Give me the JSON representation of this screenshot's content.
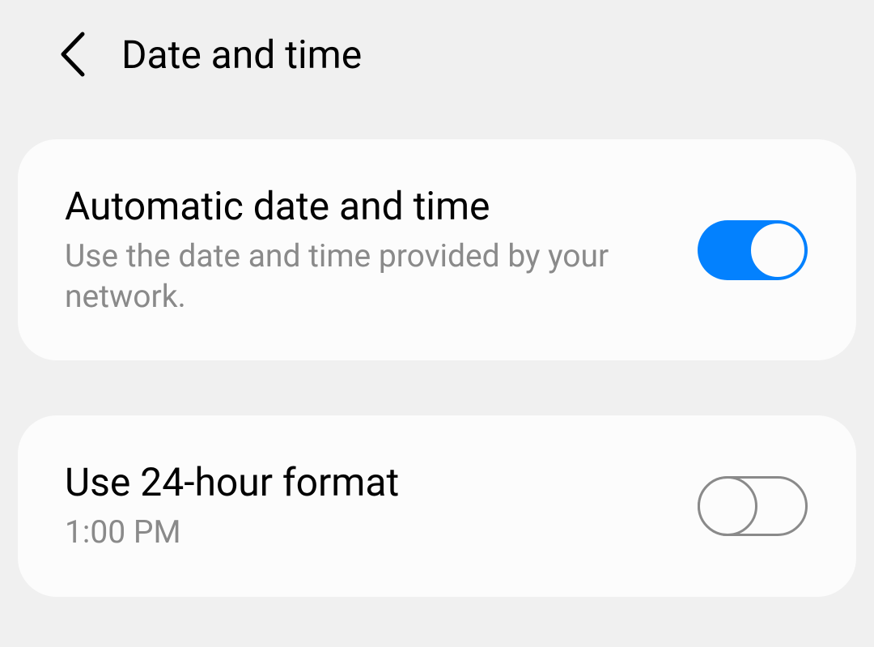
{
  "header": {
    "title": "Date and time"
  },
  "settings": {
    "automatic": {
      "title": "Automatic date and time",
      "subtitle": "Use the date and time provided by your network.",
      "enabled": true
    },
    "format24": {
      "title": "Use 24-hour format",
      "subtitle": "1:00 PM",
      "enabled": false
    }
  }
}
